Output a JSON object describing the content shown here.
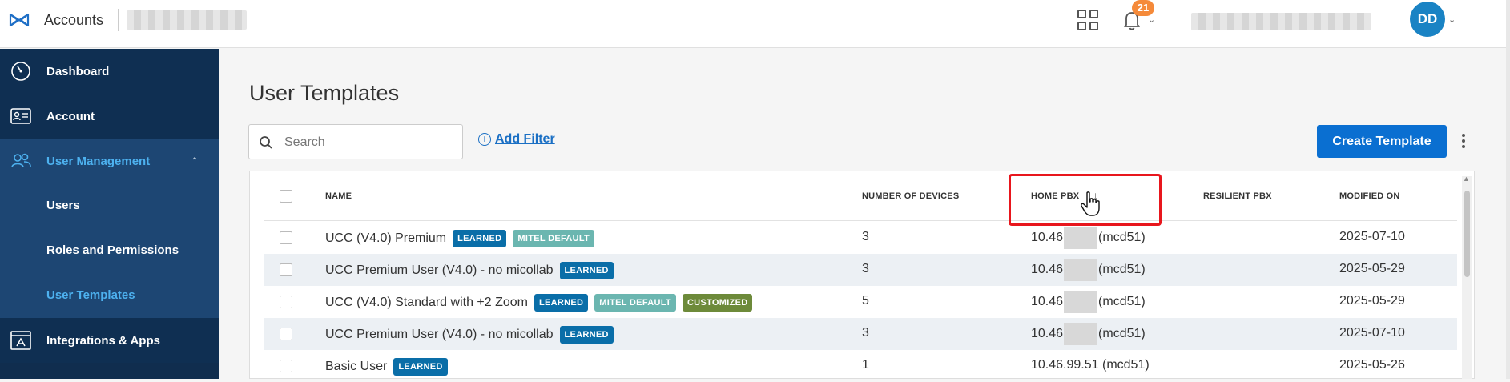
{
  "header": {
    "app_title": "Accounts",
    "notification_count": "21",
    "avatar_initials": "DD",
    "icons": [
      "logo-icon",
      "apps-grid-icon",
      "bell-icon",
      "chevron-down-icon"
    ]
  },
  "sidebar": {
    "items": [
      {
        "label": "Dashboard",
        "icon": "dashboard-icon"
      },
      {
        "label": "Account",
        "icon": "account-card-icon"
      },
      {
        "label": "User Management",
        "icon": "users-icon",
        "expanded": true
      },
      {
        "label": "Integrations & Apps",
        "icon": "integrations-icon"
      }
    ],
    "sub_items": [
      {
        "label": "Users"
      },
      {
        "label": "Roles and Permissions"
      },
      {
        "label": "User Templates",
        "active": true
      }
    ],
    "colors": {
      "bg": "#102d4e",
      "active_text": "#4db1ef"
    }
  },
  "main": {
    "page_title": "User Templates",
    "search_placeholder": "Search",
    "add_filter_label": "Add Filter",
    "create_button_label": "Create Template",
    "table": {
      "columns": [
        "NAME",
        "NUMBER OF DEVICES",
        "HOME PBX",
        "RESILIENT PBX",
        "MODIFIED ON"
      ],
      "sorted_column": "HOME PBX",
      "sort_direction": "descending",
      "rows": [
        {
          "name": "UCC (V4.0) Premium",
          "tags": [
            "LEARNED",
            "MITEL DEFAULT"
          ],
          "devices": "3",
          "home_pbx_prefix": "10.46",
          "home_pbx_suffix": "(mcd51)",
          "resilient_pbx": "",
          "modified": "2025-07-10"
        },
        {
          "name": "UCC Premium User (V4.0) - no micollab",
          "tags": [
            "LEARNED"
          ],
          "devices": "3",
          "home_pbx_prefix": "10.46",
          "home_pbx_suffix": "(mcd51)",
          "resilient_pbx": "",
          "modified": "2025-05-29"
        },
        {
          "name": "UCC (V4.0) Standard with +2 Zoom",
          "tags": [
            "LEARNED",
            "MITEL DEFAULT",
            "CUSTOMIZED"
          ],
          "devices": "5",
          "home_pbx_prefix": "10.46",
          "home_pbx_suffix": "(mcd51)",
          "resilient_pbx": "",
          "modified": "2025-05-29"
        },
        {
          "name": "UCC Premium User (V4.0) - no micollab",
          "tags": [
            "LEARNED"
          ],
          "devices": "3",
          "home_pbx_prefix": "10.46",
          "home_pbx_suffix": "(mcd51)",
          "resilient_pbx": "",
          "modified": "2025-07-10"
        },
        {
          "name": "Basic User",
          "tags": [
            "LEARNED"
          ],
          "devices": "1",
          "home_pbx_prefix": "10.46.99.51",
          "home_pbx_suffix": "(mcd51)",
          "resilient_pbx": "",
          "modified": "2025-05-26"
        }
      ]
    }
  },
  "colors": {
    "primary": "#0a6fd1",
    "learned_tag": "#0a6ea8",
    "mitel_default_tag": "#6bb6b0",
    "customized_tag": "#6d8a3a",
    "badge": "#f58a3a",
    "highlight_box": "#e8161d"
  }
}
